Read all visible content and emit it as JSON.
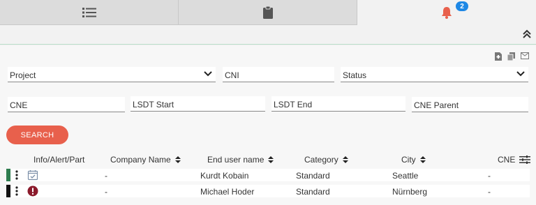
{
  "tabs": [
    {
      "icon": "list-icon"
    },
    {
      "icon": "clipboard-icon"
    },
    {
      "icon": "bell-icon",
      "badge": "2"
    }
  ],
  "filters": {
    "project": "Project",
    "cni": "CNI",
    "status": "Status",
    "cne": "CNE",
    "lsdt_start": "LSDT Start",
    "lsdt_end": "LSDT End",
    "cne_parent": "CNE Parent"
  },
  "search_label": "SEARCH",
  "table": {
    "columns": [
      "Info/Alert/Part",
      "Company Name",
      "End user name",
      "Category",
      "City",
      "CNE"
    ],
    "rows": [
      {
        "status_color": "#2e7d4f",
        "icon": "calendar-check-icon",
        "company": "-",
        "end_user": "Kurdt Kobain",
        "category": "Standard",
        "city": "Seattle",
        "cne": "-"
      },
      {
        "status_color": "#111111",
        "icon": "alert-icon",
        "company": "-",
        "end_user": "Michael Hoder",
        "category": "Standard",
        "city": "Nürnberg",
        "cne": "-"
      }
    ]
  },
  "colors": {
    "accent": "#e8604c",
    "badge": "#1e88e5"
  }
}
